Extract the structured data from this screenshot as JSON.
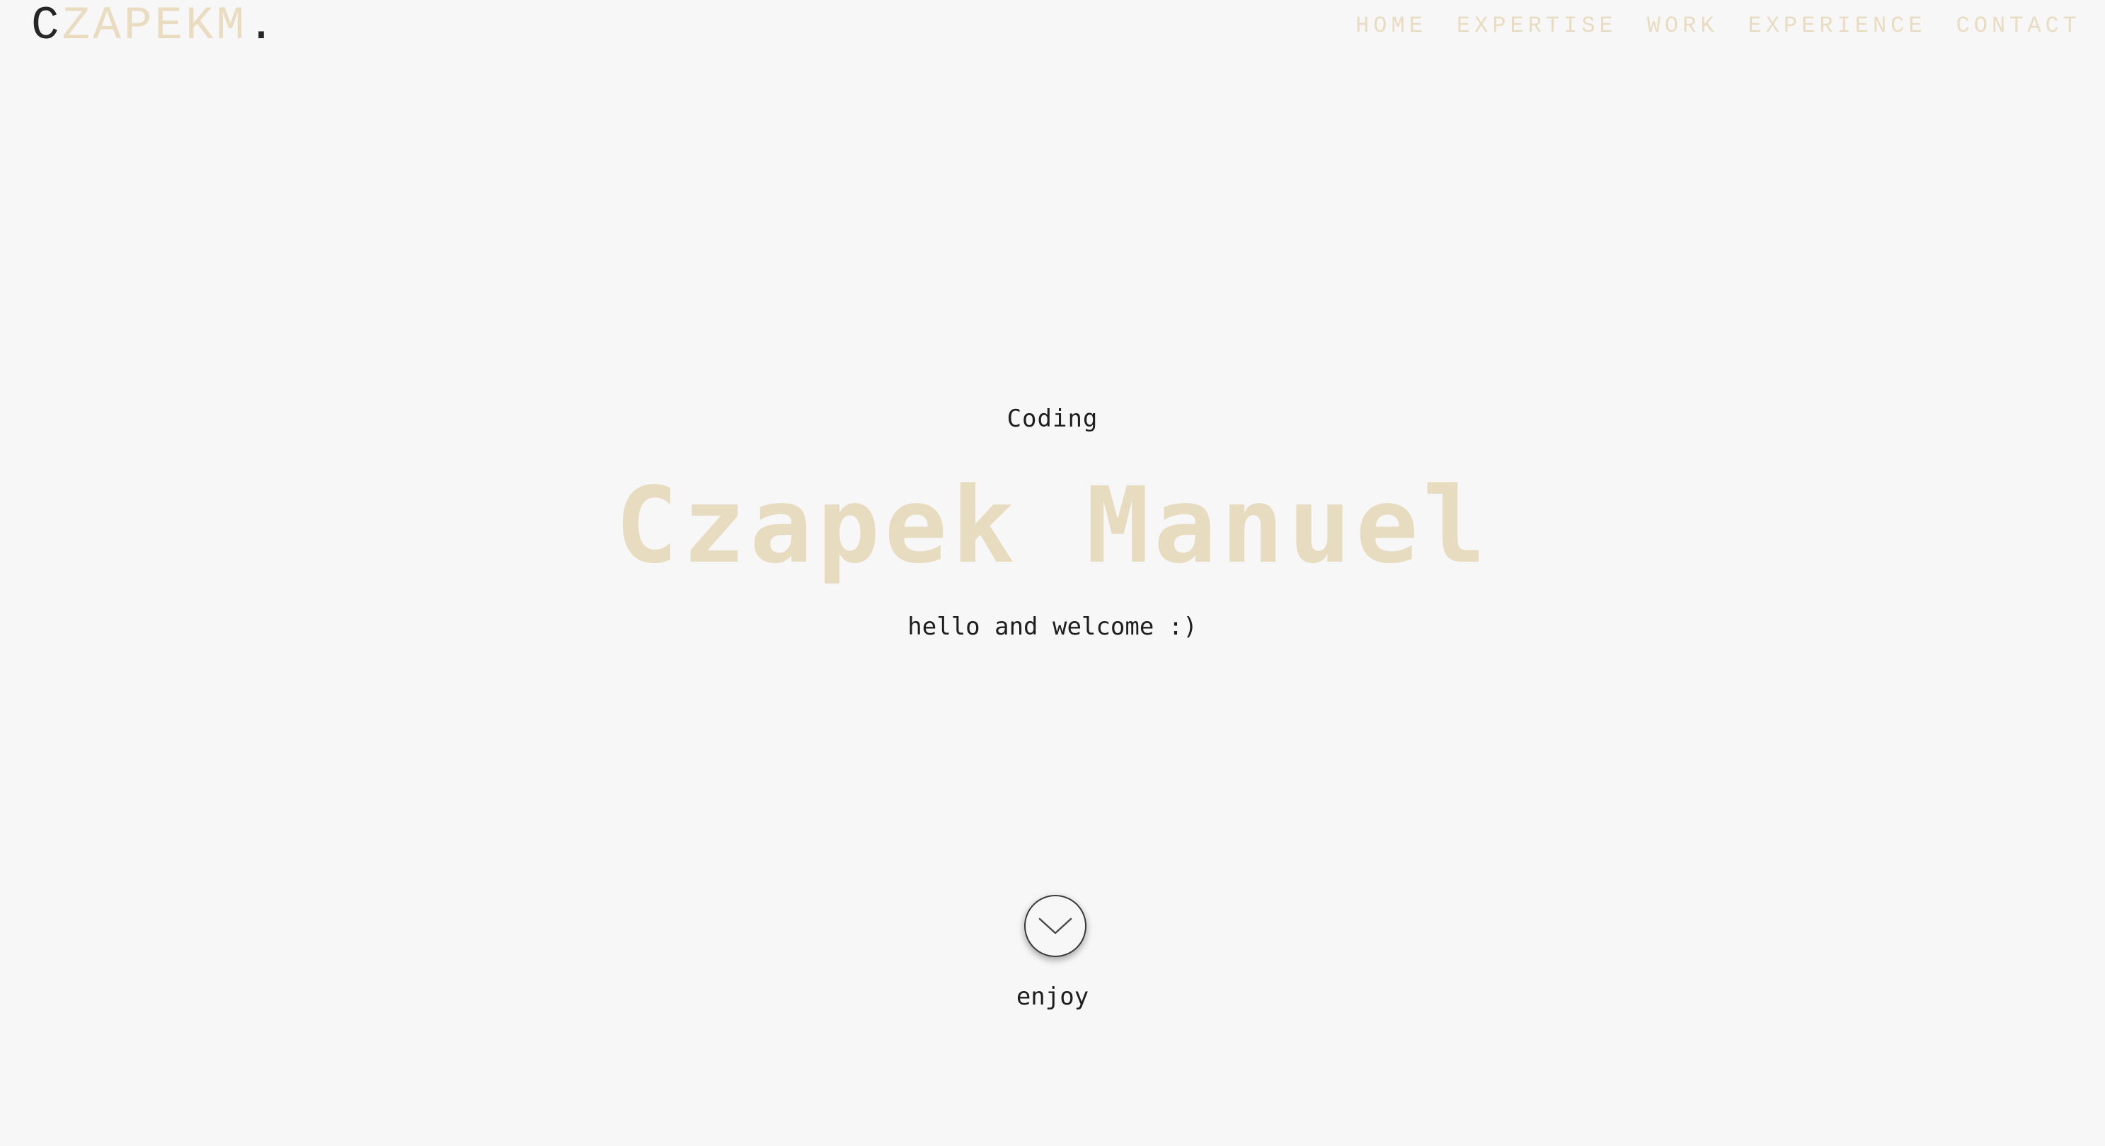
{
  "logo": {
    "first": "C",
    "rest": "ZAPEKM",
    "dot": "."
  },
  "nav": {
    "items": [
      "HOME",
      "EXPERTISE",
      "WORK",
      "EXPERIENCE",
      "CONTACT"
    ]
  },
  "hero": {
    "subtitle": "Coding",
    "name": "Czapek Manuel",
    "greeting": "hello and welcome :)",
    "scroll_icon": "chevron-down-icon",
    "scroll_label": "enjoy"
  },
  "colors": {
    "background": "#f7f7f7",
    "accent_beige": "#e9dcc0",
    "text_dark": "#1e1e1e"
  }
}
